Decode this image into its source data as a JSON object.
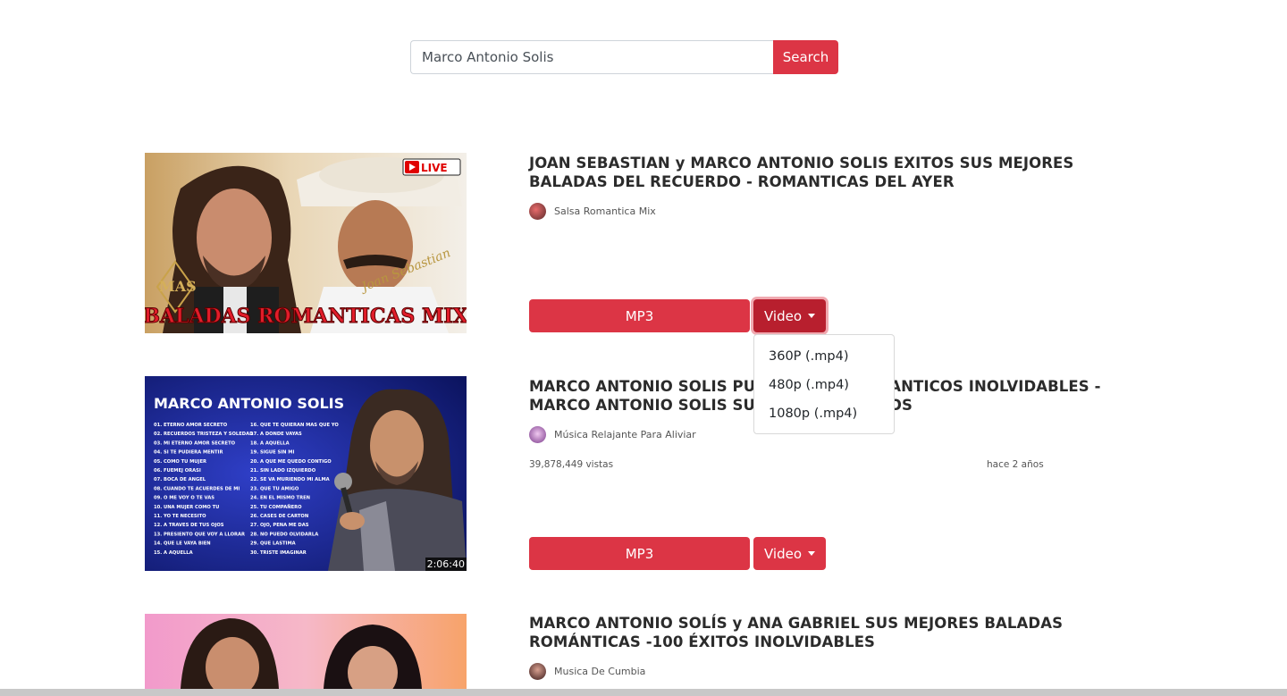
{
  "search": {
    "value": "Marco Antonio Solis",
    "button_label": "Search"
  },
  "results": [
    {
      "title": "JOAN SEBASTIAN y MARCO ANTONIO SOLIS EXITOS SUS MEJORES BALADAS DEL RECUERDO - ROMANTICAS DEL AYER",
      "channel": "Salsa Romantica Mix",
      "thumbnail": {
        "badge": "LIVE",
        "logo": "MAS",
        "caption": "BALADAS ROMANTICAS MIX",
        "signature": "Joan Sebastian"
      },
      "mp3_label": "MP3",
      "video_label": "Video"
    },
    {
      "title": "MARCO ANTONIO SOLIS PURO EXITOS ROMANTICOS INOLVIDABLES - MARCO ANTONIO SOLIS SUS MEJORES ÉXITOS",
      "channel": "Música Relajante Para Aliviar",
      "views": "39,878,449 vistas",
      "age": "hace 2 años",
      "duration": "2:06:40",
      "thumbnail": {
        "header": "MARCO ANTONIO SOLIS",
        "tracks_left": [
          "01. ETERNO AMOR SECRETO",
          "02. RECUERDOS TRISTEZA Y SOLEDAD",
          "03. MI ETERNO AMOR SECRETO",
          "04. SI TE PUDIERA MENTIR",
          "05. COMO TU MUJER",
          "06. FUEMEJ ORASI",
          "07. BOCA DE ANGEL",
          "08. CUANDO TE ACUERDES DE MI",
          "09. O ME VOY O TE VAS",
          "10. UNA MUJER COMO TU",
          "11. YO TE NECESITO",
          "12. A TRAVES DE TUS OJOS",
          "13. PRESIENTO QUE VOY A LLORAR",
          "14. QUE LE VAYA BIEN",
          "15. A AQUELLA"
        ],
        "tracks_right": [
          "16. QUE TE QUIERAN MAS QUE YO",
          "17. A DONDE VAYAS",
          "18. A AQUELLA",
          "19. SIGUE SIN MI",
          "20. A QUE ME QUEDO CONTIGO",
          "21. SIN LADO IZQUIERDO",
          "22. SE VA MURIENDO MI ALMA",
          "23. QUE TU AMIGO",
          "24. EN EL MISMO TREN",
          "25. TU COMPAÑERO",
          "26. CASES DE CARTON",
          "27. OJO, PENA ME DAS",
          "28. NO PUEDO OLVIDARLA",
          "29. QUE LASTIMA",
          "30. TRISTE IMAGINAR"
        ]
      },
      "mp3_label": "MP3",
      "video_label": "Video"
    },
    {
      "title": "MARCO ANTONIO SOLÍS y ANA GABRIEL SUS MEJORES BALADAS ROMÁNTICAS -100 ÉXITOS INOLVIDABLES",
      "channel": "Musica De Cumbia"
    }
  ],
  "dropdown": {
    "options": [
      "360P (.mp4)",
      "480p (.mp4)",
      "1080p (.mp4)"
    ]
  },
  "colors": {
    "accent": "#dc3545",
    "accent_active": "#b81f2e"
  }
}
